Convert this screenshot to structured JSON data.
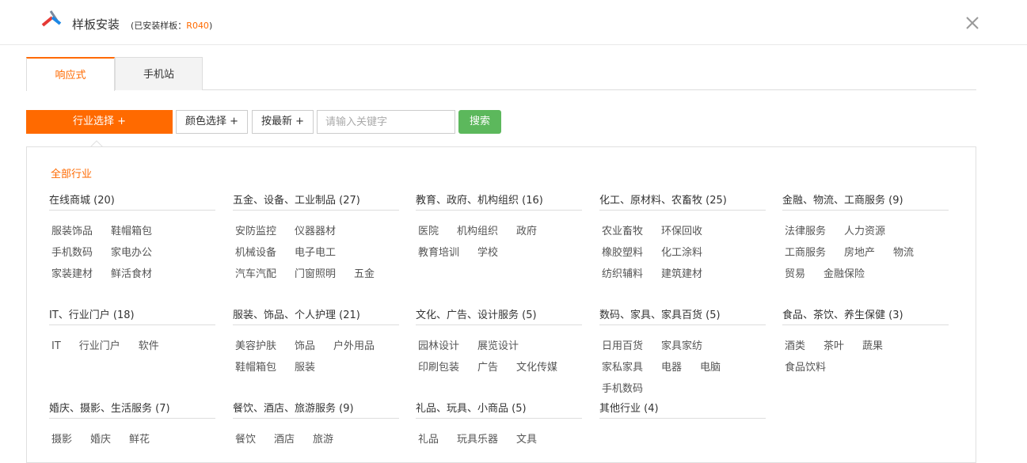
{
  "header": {
    "title": "样板安装",
    "subtitle_prefix": "(已安装样板：",
    "installed_code": "R040",
    "subtitle_suffix": ")"
  },
  "tabs": [
    {
      "label": "响应式"
    },
    {
      "label": "手机站"
    }
  ],
  "filters": {
    "industry_label": "行业选择 +",
    "color_label": "颜色选择 +",
    "newest_label": "按最新 +",
    "search_placeholder": "请输入关键字",
    "search_button": "搜索"
  },
  "all_industries": "全部行业",
  "categories": [
    {
      "title": "在线商城 (20)",
      "items": [
        "服装饰品",
        "鞋帽箱包",
        "手机数码",
        "家电办公",
        "家装建材",
        "鲜活食材"
      ]
    },
    {
      "title": "五金、设备、工业制品 (27)",
      "items": [
        "安防监控",
        "仪器器材",
        "机械设备",
        "电子电工",
        "汽车汽配",
        "门窗照明",
        "五金"
      ]
    },
    {
      "title": "教育、政府、机构组织 (16)",
      "items": [
        "医院",
        "机构组织",
        "政府",
        "教育培训",
        "学校"
      ]
    },
    {
      "title": "化工、原材料、农畜牧 (25)",
      "items": [
        "农业畜牧",
        "环保回收",
        "橡胶塑料",
        "化工涂料",
        "纺织辅料",
        "建筑建材"
      ]
    },
    {
      "title": "金融、物流、工商服务 (9)",
      "items": [
        "法律服务",
        "人力资源",
        "工商服务",
        "房地产",
        "物流",
        "贸易",
        "金融保险"
      ]
    },
    {
      "title": "IT、行业门户 (18)",
      "items": [
        "IT",
        "行业门户",
        "软件"
      ]
    },
    {
      "title": "服装、饰品、个人护理 (21)",
      "items": [
        "美容护肤",
        "饰品",
        "户外用品",
        "鞋帽箱包",
        "服装"
      ]
    },
    {
      "title": "文化、广告、设计服务 (5)",
      "items": [
        "园林设计",
        "展览设计",
        "印刷包装",
        "广告",
        "文化传媒"
      ]
    },
    {
      "title": "数码、家具、家具百货 (5)",
      "items": [
        "日用百货",
        "家具家纺",
        "家私家具",
        "电器",
        "电脑",
        "手机数码"
      ]
    },
    {
      "title": "食品、茶饮、养生保健 (3)",
      "items": [
        "酒类",
        "茶叶",
        "蔬果",
        "食品饮料"
      ]
    },
    {
      "title": "婚庆、摄影、生活服务 (7)",
      "items": [
        "摄影",
        "婚庆",
        "鲜花"
      ]
    },
    {
      "title": "餐饮、酒店、旅游服务 (9)",
      "items": [
        "餐饮",
        "酒店",
        "旅游"
      ]
    },
    {
      "title": "礼品、玩具、小商品 (5)",
      "items": [
        "礼品",
        "玩具乐器",
        "文具"
      ]
    },
    {
      "title": "其他行业 (4)",
      "items": []
    }
  ],
  "colors": {
    "accent": "#ff6a00",
    "search_button": "#5cb85c"
  }
}
